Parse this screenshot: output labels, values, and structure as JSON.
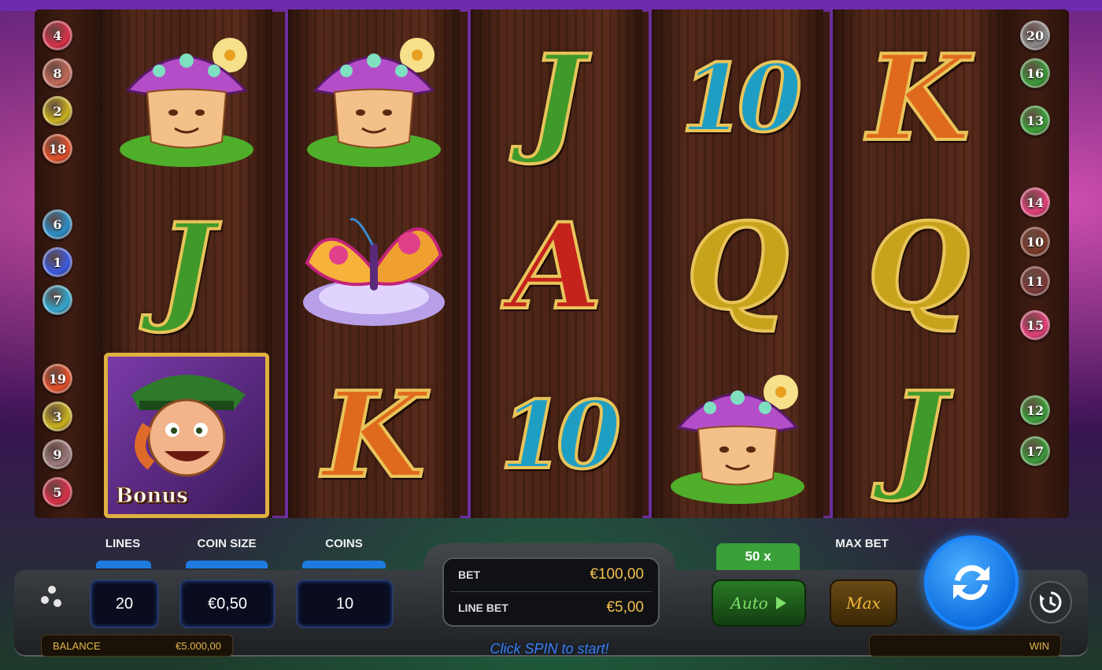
{
  "reels": [
    {
      "symbols": [
        {
          "name": "mushroom"
        },
        {
          "name": "letter-j",
          "text": "J",
          "color": "#3f9a2a"
        },
        {
          "name": "leprechaun-bonus",
          "label": "Bonus"
        }
      ]
    },
    {
      "symbols": [
        {
          "name": "mushroom"
        },
        {
          "name": "butterfly"
        },
        {
          "name": "letter-k",
          "text": "K",
          "color": "#e06a1c"
        }
      ]
    },
    {
      "symbols": [
        {
          "name": "letter-j",
          "text": "J",
          "color": "#3f9a2a"
        },
        {
          "name": "letter-a",
          "text": "A",
          "color": "#c4231c"
        },
        {
          "name": "ten",
          "text": "10",
          "color": "#1f9ec4"
        }
      ]
    },
    {
      "symbols": [
        {
          "name": "ten",
          "text": "10",
          "color": "#1f9ec4"
        },
        {
          "name": "letter-q",
          "text": "Q",
          "color": "#c7a31c"
        },
        {
          "name": "mushroom"
        }
      ]
    },
    {
      "symbols": [
        {
          "name": "letter-k",
          "text": "K",
          "color": "#e06a1c"
        },
        {
          "name": "letter-q",
          "text": "Q",
          "color": "#c7a31c"
        },
        {
          "name": "letter-j",
          "text": "J",
          "color": "#3f9a2a"
        }
      ]
    }
  ],
  "paylines_left": [
    {
      "n": "4",
      "color": "#d7304a"
    },
    {
      "n": "8",
      "color": "#c26a5a"
    },
    {
      "n": "2",
      "color": "#c8b21e"
    },
    {
      "n": "18",
      "color": "#e2502a"
    },
    {
      "n": "6",
      "color": "#2a8ec8"
    },
    {
      "n": "1",
      "color": "#3a5ae0"
    },
    {
      "n": "7",
      "color": "#30a8d0"
    },
    {
      "n": "19",
      "color": "#e2502a"
    },
    {
      "n": "3",
      "color": "#c8b21e"
    },
    {
      "n": "9",
      "color": "#9a7a7a"
    },
    {
      "n": "5",
      "color": "#d7304a"
    }
  ],
  "paylines_right": [
    {
      "n": "20",
      "color": "#8a8a8a"
    },
    {
      "n": "16",
      "color": "#3a9a3a"
    },
    {
      "n": "13",
      "color": "#3aa03a"
    },
    {
      "n": "14",
      "color": "#e0407a"
    },
    {
      "n": "10",
      "color": "#7a3a2a"
    },
    {
      "n": "11",
      "color": "#7a3a3a"
    },
    {
      "n": "15",
      "color": "#e0407a"
    },
    {
      "n": "12",
      "color": "#3aa03a"
    },
    {
      "n": "17",
      "color": "#3a9a3a"
    }
  ],
  "controls": {
    "lines_label": "LINES",
    "lines_value": "20",
    "coin_size_label": "COIN SIZE",
    "coin_size_value": "€0,50",
    "coins_label": "COINS",
    "coins_value": "10",
    "bet_label": "BET",
    "bet_value": "€100,00",
    "line_bet_label": "LINE BET",
    "line_bet_value": "€5,00",
    "multiplier": "50 x",
    "auto_label": "Auto",
    "max_bet_label": "MAX BET",
    "max_label": "Max",
    "balance_label": "BALANCE",
    "balance_value": "€5.000,00",
    "win_label": "WIN",
    "prompt": "Click SPIN to start!"
  },
  "icons": [
    "menu-icon",
    "spin-arrows-icon",
    "history-icon",
    "play-icon"
  ]
}
